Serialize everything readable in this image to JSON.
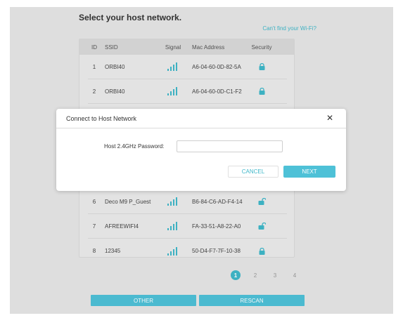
{
  "page": {
    "title": "Select your host network.",
    "cant_find": "Can't find your Wi-Fi?"
  },
  "table": {
    "headers": {
      "id": "ID",
      "ssid": "SSID",
      "signal": "Signal",
      "mac": "Mac Address",
      "security": "Security"
    },
    "rows": [
      {
        "id": "1",
        "ssid": "ORBI40",
        "mac": "A6-04-60-0D-82-5A",
        "security": "locked"
      },
      {
        "id": "2",
        "ssid": "ORBI40",
        "mac": "A6-04-60-0D-C1-F2",
        "security": "locked"
      },
      {
        "id": "6",
        "ssid": "Deco M9 P_Guest",
        "mac": "B6-84-C6-AD-F4-14",
        "security": "open"
      },
      {
        "id": "7",
        "ssid": "AFREEWIFI4",
        "mac": "FA-33-51-A8-22-A0",
        "security": "open"
      },
      {
        "id": "8",
        "ssid": "12345",
        "mac": "50-D4-F7-7F-10-38",
        "security": "locked"
      }
    ]
  },
  "modal": {
    "title": "Connect to Host Network",
    "password_label": "Host 2.4GHz Password:",
    "password_value": "",
    "cancel_label": "CANCEL",
    "next_label": "NEXT"
  },
  "pagination": {
    "pages": [
      "1",
      "2",
      "3",
      "4"
    ],
    "current": "1"
  },
  "footer": {
    "other_label": "OTHER",
    "rescan_label": "RESCAN"
  },
  "colors": {
    "accent": "#3fb7c9",
    "button": "#4ec1d7"
  },
  "icons": {
    "signal": "signal-bars-icon",
    "lock": "lock-icon",
    "unlock": "unlock-icon",
    "close": "close-icon"
  }
}
